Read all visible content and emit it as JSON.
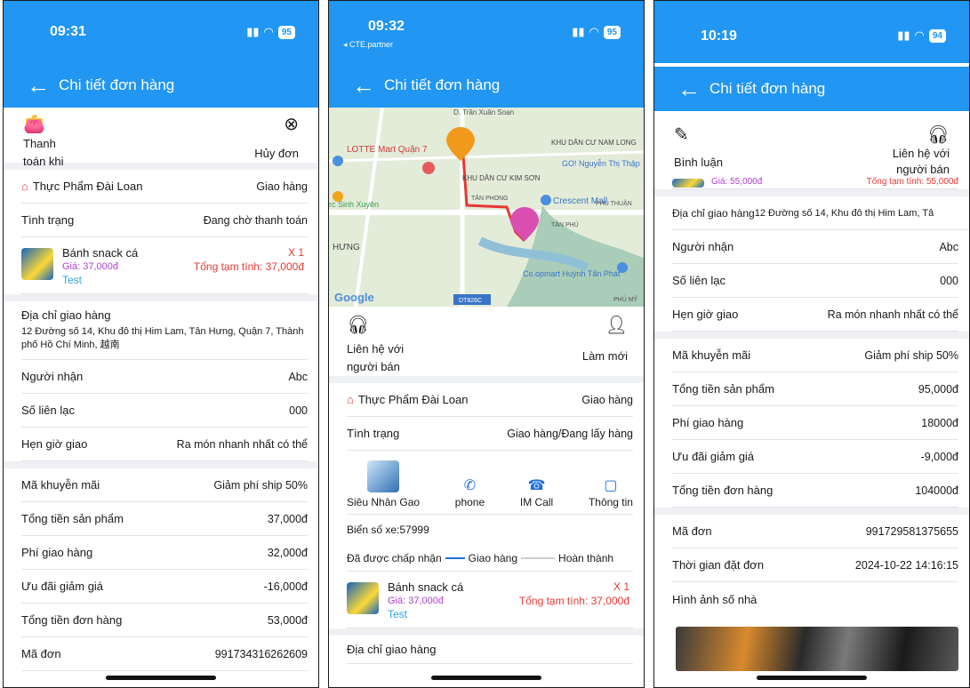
{
  "common": {
    "title": "Chi tiết đơn hàng",
    "shop_name": "Thực Phẩm Đài Loan",
    "delivery_method": "Giao hàng",
    "status_label": "Tình trạng",
    "product": {
      "name": "Bánh snack cá",
      "price": "Giá: 37,000đ",
      "note": "Test",
      "qty": "X 1",
      "subtotal": "Tổng tạm tính: 37,000đ"
    },
    "address_label": "Địa chỉ giao hàng",
    "receiver_label": "Người nhận",
    "receiver_value": "Abc",
    "phone_label": "Số liên lạc",
    "phone_value": "000",
    "schedule_label": "Hẹn giờ giao",
    "schedule_value": "Ra món nhanh nhất có thể",
    "promo_label": "Mã khuyễn mãi",
    "promo_value": "Giảm phí ship 50%",
    "products_total_label": "Tổng tiền sản phẩm",
    "shipping_label": "Phí giao hàng",
    "discount_label": "Ưu đãi giảm giá",
    "order_total_label": "Tổng tiền đơn hàng",
    "order_code_label": "Mã đơn"
  },
  "screen1": {
    "time": "09:31",
    "battery": "95",
    "pay_label": "Thanh\ntoán khi",
    "cancel_label": "Hủy đơn",
    "status_value": "Đang chờ thanh toán",
    "address_full": "12 Đường số 14, Khu đô thị Him Lam, Tân Hưng, Quận 7, Thành phố Hồ Chí Minh, 越南",
    "products_total": "37,000đ",
    "shipping": "32,000đ",
    "discount": "-16,000đ",
    "order_total": "53,000đ",
    "order_code": "991734316262609"
  },
  "screen2": {
    "time": "09:32",
    "carrier": "◂ CTE.partner",
    "battery": "95",
    "map": {
      "labels": [
        "D. Trần Xuân Soạn",
        "LOTTE Mart Quận 7",
        "KHU DÂN CƯ NAM LONG",
        "GO! Nguyễn Thị Thập",
        "KHU DÂN CƯ KIM SƠN",
        "TÂN PHONG",
        "Crescent Mall",
        "PHÚ THUẬN",
        "rc Sinh Xuyên",
        "TÂN PHÚ",
        "HƯNG",
        "Co.opmart Huỳnh Tấn Phát",
        "PHÚ MỸ",
        "DT826C",
        "Google"
      ]
    },
    "contact_label": "Liên hệ với\nngười bán",
    "refresh_label": "Làm mới",
    "status_value": "Giao hàng/Đang lấy hàng",
    "driver_name": "Siêu Nhân Gao",
    "phone_btn": "phone",
    "imcall_btn": "IM Call",
    "info_btn": "Thông tin",
    "plate": "Biển số xe:57999",
    "steps": [
      "Đã được chấp nhận",
      "Giao hàng",
      "Hoàn thành"
    ]
  },
  "screen3": {
    "time": "10:19",
    "battery": "94",
    "comment_label": "Bình luận",
    "contact_label": "Liên hệ với\nngười bán",
    "cut_price": "Giá: 55,000đ",
    "cut_subtotal": "Tổng tạm tính: 55,000đ",
    "address_inline": "12 Đường số 14, Khu đô thị Him Lam, Tâ",
    "products_total": "95,000đ",
    "shipping": "18000đ",
    "discount": "-9,000đ",
    "order_total": "104000đ",
    "order_code": "991729581375655",
    "order_time_label": "Thời gian đặt đơn",
    "order_time": "2024-10-22 14:16:15",
    "house_photo_label": "Hình ảnh số nhà"
  },
  "colors": {
    "primary": "#2196f3",
    "accent_red": "#e53935",
    "price_purple": "#b03fd4",
    "note_blue": "#29a3e8"
  }
}
